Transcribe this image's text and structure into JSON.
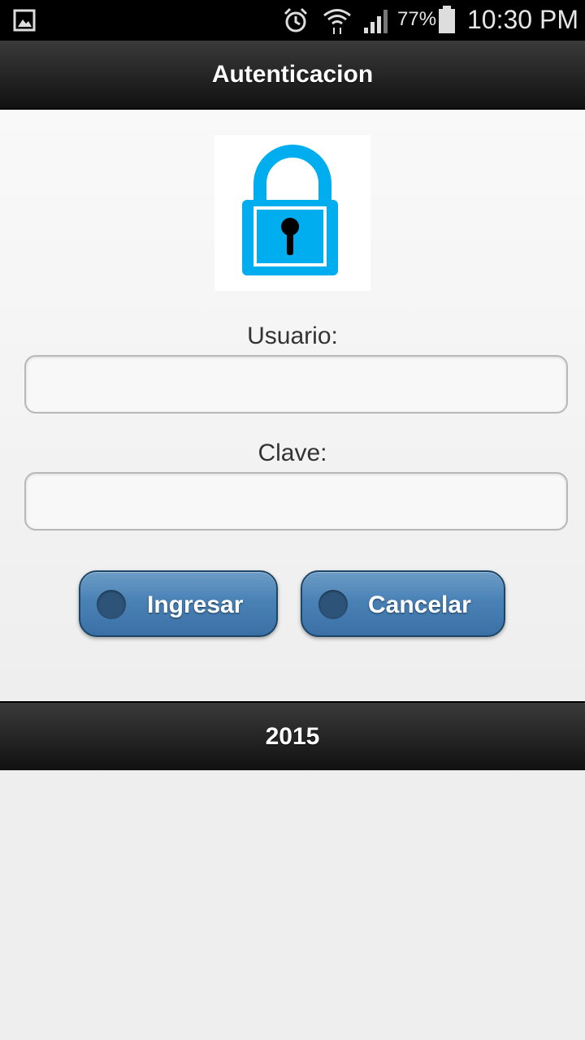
{
  "status_bar": {
    "battery_percent": "77%",
    "time": "10:30 PM",
    "icons": [
      "gallery-icon",
      "alarm-icon",
      "wifi-icon",
      "signal-icon",
      "battery-icon"
    ]
  },
  "header": {
    "title": "Autenticacion"
  },
  "login": {
    "image_icon": "lock-icon",
    "user_label": "Usuario:",
    "user_value": "",
    "password_label": "Clave:",
    "password_value": "",
    "submit_label": "Ingresar",
    "cancel_label": "Cancelar"
  },
  "footer": {
    "text": "2015"
  },
  "colors": {
    "accent": "#00aeef",
    "button_blue": "#4a82b6",
    "bar_dark": "#1c1c1c"
  }
}
